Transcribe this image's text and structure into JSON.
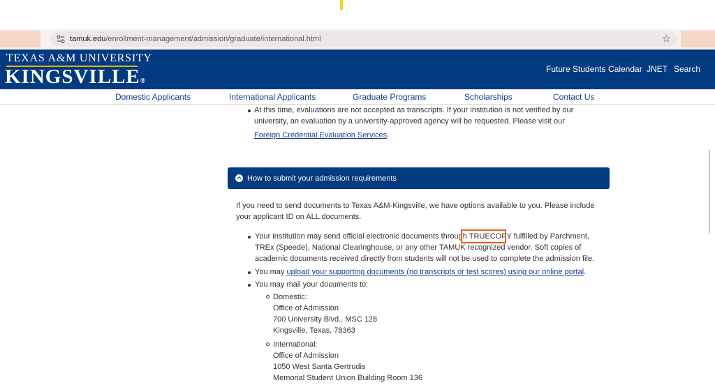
{
  "browser": {
    "url_host": "tamuk.edu",
    "url_path": "/enrollment-management/admission/graduate/international.html"
  },
  "header": {
    "logo_top": "TEXAS A&M UNIVERSITY",
    "logo_main": "KINGSVILLE",
    "logo_reg": "®",
    "top_nav": [
      "Future Students",
      "Calendar",
      "JNET",
      "Search"
    ]
  },
  "subnav": [
    "Domestic Applicants",
    "International Applicants",
    "Graduate Programs",
    "Scholarships",
    "Contact Us"
  ],
  "eval": {
    "line1": "At this time, evaluations are not accepted as transcripts.  If your institution is not verified by our",
    "line2": "university, an evaluation by a university-approved agency will be requested. Please visit our",
    "link": "Foreign Credential Evaluation Services",
    "period": "."
  },
  "accordion": {
    "title": "How to submit your admission requirements"
  },
  "intro": {
    "line1": "If you need to send documents to Texas A&M-Kingsville, we have options available to you. Please include",
    "line2": "your applicant ID on ALL documents."
  },
  "bullets": {
    "b1_pre": "Your institution may send official electronic documents through ",
    "b1_highlight": "TRUECOPY",
    "b1_post": " fulfilled by Parchment,",
    "b1_line2": "TREx (Speede), National Clearinghouse, or any other TAMUK recognized vendor. Soft copies of",
    "b1_line3": "academic documents received directly from students will not be used to complete the admission file.",
    "b2_pre": "You may ",
    "b2_link": "upload your supporting documents (no transcripts or test scores) using our online portal",
    "b2_post": ".",
    "b3": "You may mail your documents to:"
  },
  "mail": {
    "domestic": {
      "label": "Domestic:",
      "lines": [
        "Office of Admission",
        "700 University Blvd., MSC 128",
        "Kingsville, Texas, 78363"
      ]
    },
    "international": {
      "label": "International:",
      "lines": [
        "Office of Admission",
        "1050 West Santa Gertrudis",
        "Memorial Student Union Building Room 136"
      ]
    }
  },
  "colors": {
    "brand_blue": "#003a80",
    "link_blue": "#1a3d8f",
    "highlight_orange": "#e0651c",
    "gold": "#f1b300"
  }
}
